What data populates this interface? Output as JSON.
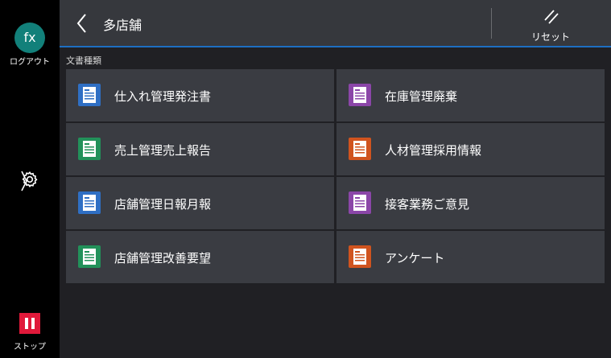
{
  "sidebar": {
    "avatar_text": "fx",
    "logout_label": "ログアウト",
    "stop_label": "ストップ"
  },
  "header": {
    "title": "多店舗",
    "reset_label": "リセット"
  },
  "section": {
    "label": "文書種類"
  },
  "documents": [
    {
      "label": "仕入れ管理発注書",
      "color": "#2f6fc4"
    },
    {
      "label": "在庫管理廃棄",
      "color": "#8b46a8"
    },
    {
      "label": "売上管理売上報告",
      "color": "#22915a"
    },
    {
      "label": "人材管理採用情報",
      "color": "#d0541f"
    },
    {
      "label": "店舗管理日報月報",
      "color": "#2f6fc4"
    },
    {
      "label": "接客業務ご意見",
      "color": "#8b46a8"
    },
    {
      "label": "店舗管理改善要望",
      "color": "#22915a"
    },
    {
      "label": "アンケート",
      "color": "#d0541f"
    }
  ],
  "icons": {
    "back": "chevron-left-icon",
    "reset": "reset-slash-icon",
    "settings": "gear-icon",
    "stop": "stop-icon",
    "document": "document-icon"
  }
}
